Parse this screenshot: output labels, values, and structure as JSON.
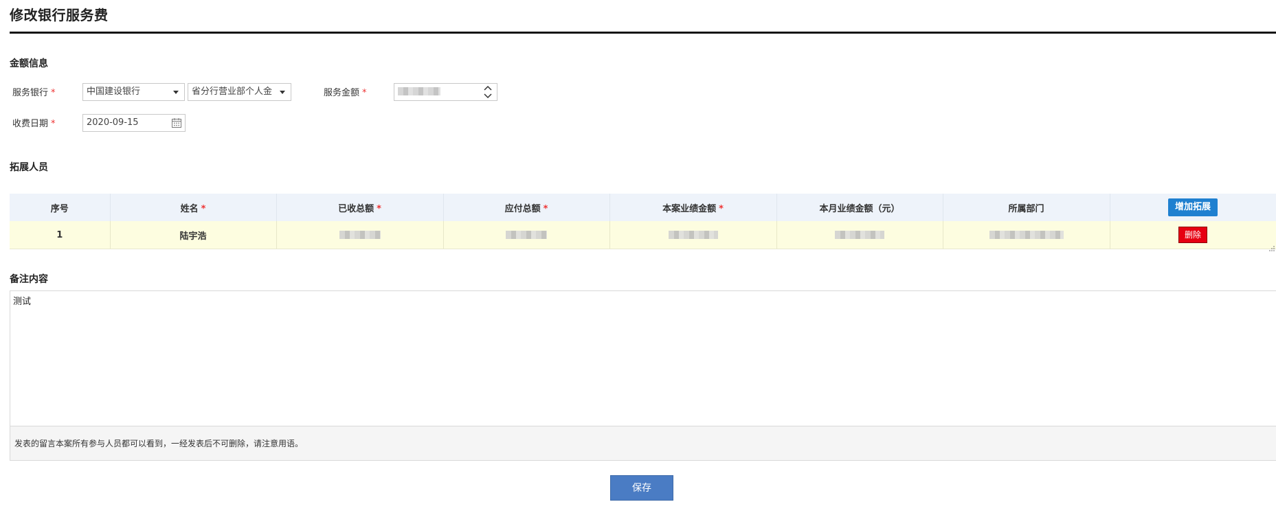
{
  "page": {
    "title": "修改银行服务费"
  },
  "amount_section": {
    "title": "金额信息",
    "bank_label": "服务银行",
    "bank_value": "中国建设银行",
    "branch_value": "省分行营业部个人金",
    "amount_label": "服务金额",
    "date_label": "收费日期",
    "date_value": "2020-09-15",
    "required_mark": "*"
  },
  "extension_section": {
    "title": "拓展人员",
    "columns": {
      "index": "序号",
      "name": "姓名",
      "received_total": "已收总额",
      "payable_total": "应付总额",
      "case_amount": "本案业绩金额",
      "month_amount": "本月业绩金额（元）",
      "department": "所属部门"
    },
    "add_button": "增加拓展",
    "rows": [
      {
        "index": "1",
        "name": "陆宇浩",
        "delete_button": "删除"
      }
    ]
  },
  "remark_section": {
    "title": "备注内容",
    "content": "测试",
    "notice": "发表的留言本案所有参与人员都可以看到，一经发表后不可删除，请注意用语。"
  },
  "actions": {
    "save": "保存"
  },
  "colors": {
    "accent": "#1f80d0",
    "danger": "#e60012",
    "save": "#4a7cc4",
    "required": "#ee3333"
  }
}
